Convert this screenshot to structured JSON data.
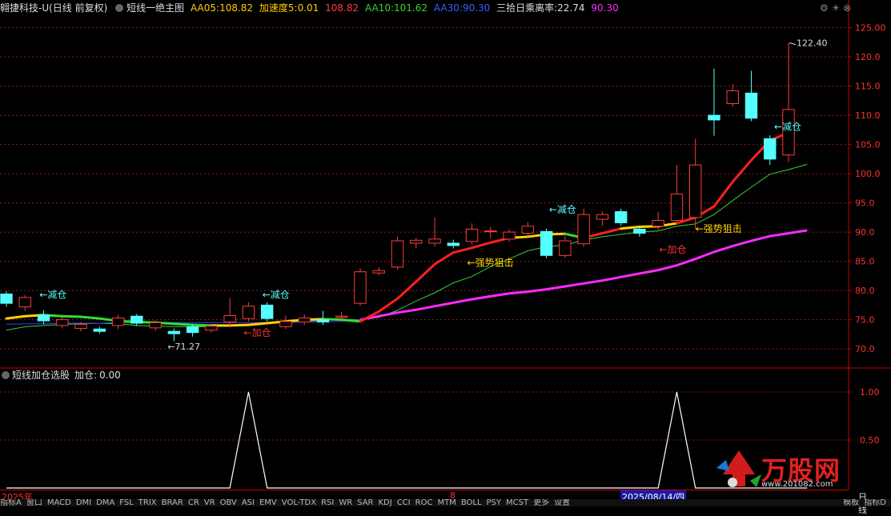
{
  "header": {
    "stock_name": "翱捷科技-U",
    "period": "(日线 前复权)",
    "indicator_name": "短线一绝主图",
    "aa05_label": "AA05:",
    "aa05_value": "108.82",
    "accel_label": "加速度5:",
    "accel_value": "0.01",
    "accel_extra": "108.82",
    "aa10_label": "AA10:",
    "aa10_value": "101.62",
    "aa30_label": "AA30:",
    "aa30_value": "90.30",
    "deviation_label": "三拾日乘离率:",
    "deviation_value": "22.74",
    "deviation_extra": "90.30"
  },
  "indicator_panel": {
    "name": "短线加仓选股",
    "jiacang_label": "加仓:",
    "jiacang_value": "0.00"
  },
  "main_axis": {
    "ylim": [
      67,
      127
    ],
    "ticks": [
      "125.00",
      "120.0",
      "115.0",
      "110.0",
      "105.0",
      "100.0",
      "95.0",
      "90.0",
      "85.0",
      "80.0",
      "75.0",
      "70.0"
    ]
  },
  "sub_axis": {
    "ylim": [
      0,
      1.1
    ],
    "ticks": [
      "1.00",
      "0.50"
    ]
  },
  "annotations": {
    "high_label": "122.40",
    "low_label": "71.27",
    "reduce": "←减仓",
    "add": "←加仓",
    "strong": "←强势狙击"
  },
  "colors": {
    "up": "#ff3c3c",
    "down": "#54ffff",
    "aa05": "#ff2020",
    "aa10": "#37d037",
    "aa30": "#ff2aff",
    "grid": "#8a1f1f"
  },
  "date_bar": {
    "year": "2025年",
    "month": "8",
    "cursor_date": "2025/08/14/四",
    "right_label": "日线"
  },
  "bottom_tabs": [
    "指标A",
    "窗口",
    "MACD",
    "DMI",
    "DMA",
    "FSL",
    "TRIX",
    "BRAR",
    "CR",
    "VR",
    "OBV",
    "ASI",
    "EMV",
    "VOL-TDX",
    "RSI",
    "WR",
    "SAR",
    "KDJ",
    "CCI",
    "ROC",
    "MTM",
    "BOLL",
    "PSY",
    "MCST",
    "更多",
    "设置"
  ],
  "bottom_right": [
    "指标D",
    "模板"
  ],
  "watermark": "万股网",
  "watermark_url": "www.201082.com",
  "chart_data": {
    "type": "candlestick",
    "candles": [
      {
        "o": 79.4,
        "c": 77.8,
        "h": 79.9,
        "l": 77.2
      },
      {
        "o": 77.2,
        "c": 78.8,
        "h": 79.2,
        "l": 76.5
      },
      {
        "o": 75.8,
        "c": 74.8,
        "h": 76.6,
        "l": 74.2
      },
      {
        "o": 74.0,
        "c": 75.0,
        "h": 75.4,
        "l": 73.5
      },
      {
        "o": 73.5,
        "c": 74.2,
        "h": 74.6,
        "l": 73.0
      },
      {
        "o": 73.4,
        "c": 73.0,
        "h": 73.8,
        "l": 72.6
      },
      {
        "o": 74.0,
        "c": 75.3,
        "h": 75.8,
        "l": 73.4
      },
      {
        "o": 75.6,
        "c": 74.4,
        "h": 76.0,
        "l": 73.9
      },
      {
        "o": 73.6,
        "c": 74.5,
        "h": 74.9,
        "l": 73.1
      },
      {
        "o": 73.0,
        "c": 72.6,
        "h": 73.5,
        "l": 71.3
      },
      {
        "o": 73.8,
        "c": 72.8,
        "h": 74.1,
        "l": 72.1
      },
      {
        "o": 73.2,
        "c": 73.9,
        "h": 74.3,
        "l": 72.8
      },
      {
        "o": 74.6,
        "c": 75.7,
        "h": 78.7,
        "l": 73.9
      },
      {
        "o": 75.2,
        "c": 77.3,
        "h": 78.0,
        "l": 74.7
      },
      {
        "o": 77.5,
        "c": 75.2,
        "h": 78.0,
        "l": 74.7
      },
      {
        "o": 73.8,
        "c": 74.7,
        "h": 75.7,
        "l": 73.4
      },
      {
        "o": 74.6,
        "c": 75.3,
        "h": 75.9,
        "l": 74.1
      },
      {
        "o": 75.0,
        "c": 74.6,
        "h": 76.5,
        "l": 74.1
      },
      {
        "o": 75.4,
        "c": 75.6,
        "h": 76.3,
        "l": 74.9
      },
      {
        "o": 77.8,
        "c": 83.2,
        "h": 83.8,
        "l": 77.4
      },
      {
        "o": 83.0,
        "c": 83.4,
        "h": 84.0,
        "l": 82.6
      },
      {
        "o": 84.0,
        "c": 88.5,
        "h": 89.2,
        "l": 83.6
      },
      {
        "o": 88.1,
        "c": 88.6,
        "h": 89.0,
        "l": 87.2
      },
      {
        "o": 88.1,
        "c": 88.8,
        "h": 92.5,
        "l": 87.5
      },
      {
        "o": 88.1,
        "c": 87.7,
        "h": 88.7,
        "l": 87.2
      },
      {
        "o": 88.4,
        "c": 90.5,
        "h": 91.5,
        "l": 87.9
      },
      {
        "o": 90.1,
        "c": 90.2,
        "h": 90.9,
        "l": 88.9
      },
      {
        "o": 88.8,
        "c": 90.0,
        "h": 90.5,
        "l": 88.3
      },
      {
        "o": 89.8,
        "c": 91.0,
        "h": 91.7,
        "l": 89.2
      },
      {
        "o": 90.1,
        "c": 86.0,
        "h": 90.6,
        "l": 85.5
      },
      {
        "o": 86.0,
        "c": 88.5,
        "h": 89.4,
        "l": 85.6
      },
      {
        "o": 88.0,
        "c": 93.0,
        "h": 94.0,
        "l": 87.5
      },
      {
        "o": 92.2,
        "c": 93.0,
        "h": 93.5,
        "l": 91.1
      },
      {
        "o": 93.5,
        "c": 91.6,
        "h": 94.0,
        "l": 91.1
      },
      {
        "o": 90.5,
        "c": 89.8,
        "h": 91.0,
        "l": 89.2
      },
      {
        "o": 91.0,
        "c": 92.0,
        "h": 93.5,
        "l": 90.4
      },
      {
        "o": 92.0,
        "c": 96.5,
        "h": 101.5,
        "l": 91.6
      },
      {
        "o": 92.5,
        "c": 101.5,
        "h": 106.0,
        "l": 90.5
      },
      {
        "o": 110.0,
        "c": 109.2,
        "h": 118.0,
        "l": 106.5
      },
      {
        "o": 112.0,
        "c": 114.2,
        "h": 115.3,
        "l": 111.5
      },
      {
        "o": 113.8,
        "c": 109.5,
        "h": 117.6,
        "l": 109.0
      },
      {
        "o": 106.0,
        "c": 102.5,
        "h": 106.6,
        "l": 101.5
      },
      {
        "o": 103.2,
        "c": 111.0,
        "h": 122.4,
        "l": 102.0
      }
    ],
    "aa05": [
      75.2,
      75.6,
      75.8,
      75.6,
      75.5,
      75.2,
      74.8,
      74.6,
      74.5,
      74.3,
      74.1,
      74.0,
      74.0,
      74.1,
      74.4,
      74.7,
      75.0,
      75.1,
      75.0,
      74.7,
      76.4,
      78.6,
      81.5,
      84.5,
      86.5,
      87.3,
      88.2,
      89.0,
      89.2,
      89.6,
      89.7,
      89.0,
      89.8,
      90.6,
      90.9,
      91.0,
      91.5,
      92.5,
      94.4,
      98.6,
      102.3,
      105.7,
      107.0,
      108.8
    ],
    "aa10": [
      73.2,
      73.8,
      74.0,
      74.2,
      74.3,
      74.4,
      74.3,
      74.0,
      73.9,
      73.8,
      73.8,
      73.8,
      73.9,
      74.2,
      74.5,
      74.7,
      74.7,
      74.9,
      75.0,
      75.0,
      75.4,
      76.6,
      78.2,
      79.6,
      81.3,
      82.4,
      84.1,
      85.4,
      86.8,
      87.5,
      87.8,
      88.6,
      89.2,
      89.6,
      90.0,
      90.2,
      91.0,
      91.4,
      93.0,
      95.4,
      97.7,
      99.9,
      100.7,
      101.6
    ],
    "aa30": [
      74.2,
      74.3,
      74.3,
      74.4,
      74.4,
      74.4,
      74.5,
      74.5,
      74.5,
      74.5,
      74.5,
      74.5,
      74.5,
      74.5,
      74.5,
      74.5,
      74.6,
      74.6,
      74.7,
      75.0,
      75.6,
      76.2,
      76.7,
      77.3,
      77.9,
      78.5,
      79.0,
      79.5,
      79.8,
      80.2,
      80.7,
      81.2,
      81.7,
      82.3,
      82.9,
      83.5,
      84.3,
      85.4,
      86.6,
      87.6,
      88.5,
      89.3,
      89.8,
      90.3
    ],
    "jiacang": [
      0,
      0,
      0,
      0,
      0,
      0,
      0,
      0,
      0,
      0,
      0,
      0,
      0,
      1,
      0,
      0,
      0,
      0,
      0,
      0,
      0,
      0,
      0,
      0,
      0,
      0,
      0,
      0,
      0,
      0,
      0,
      0,
      0,
      0,
      0,
      0,
      1,
      0,
      0,
      0,
      0,
      0,
      0,
      0
    ]
  }
}
